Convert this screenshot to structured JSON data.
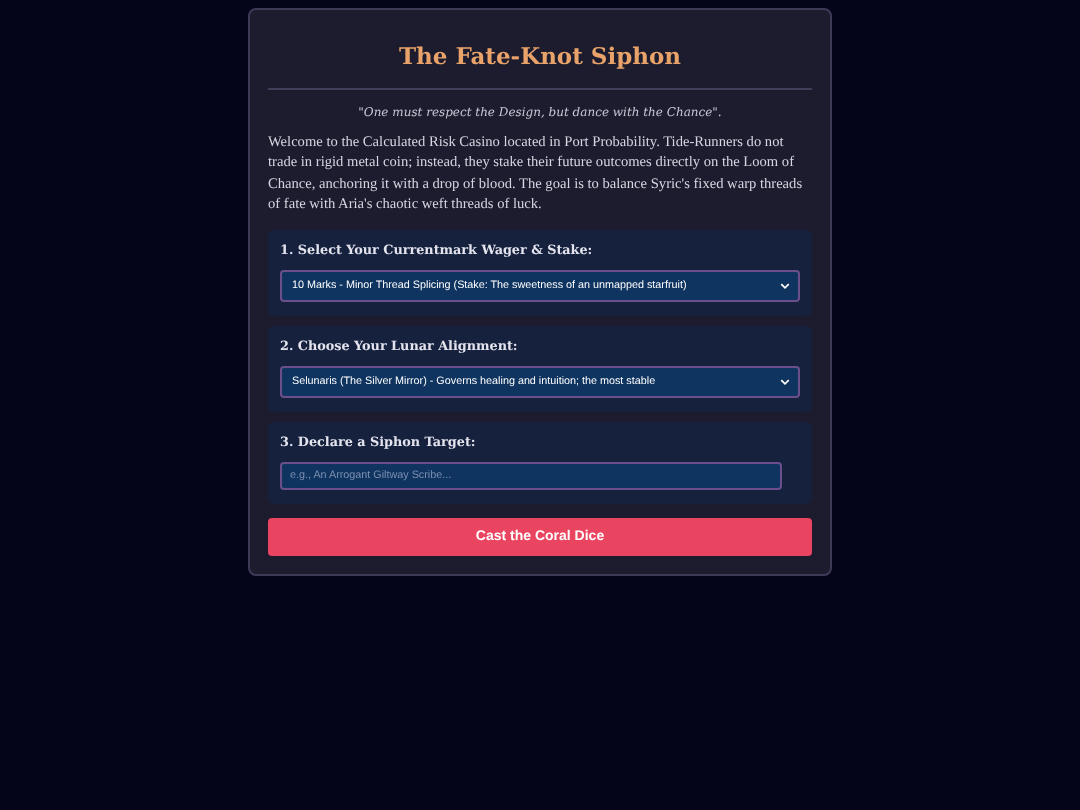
{
  "title": "The Fate-Knot Siphon",
  "quote": "\"One must respect the Design, but dance with the Chance\".",
  "intro": "Welcome to the Calculated Risk Casino located in Port Probability. Tide-Runners do not trade in rigid metal coin; instead, they stake their future outcomes directly on the Loom of Chance, anchoring it with a drop of blood. The goal is to balance Syric's fixed warp threads of fate with Aria's chaotic weft threads of luck.",
  "sections": [
    {
      "kind": "select",
      "label": "1. Select Your Currentmark Wager & Stake:",
      "value": "10 Marks - Minor Thread Splicing (Stake: The sweetness of an unmapped starfruit)"
    },
    {
      "kind": "select",
      "label": "2. Choose Your Lunar Alignment:",
      "value": "Selunaris (The Silver Mirror) - Governs healing and intuition; the most stable"
    },
    {
      "kind": "text",
      "label": "3. Declare a Siphon Target:",
      "placeholder": "e.g., An Arrogant Giltway Scribe..."
    }
  ],
  "button": "Cast the Coral Dice"
}
